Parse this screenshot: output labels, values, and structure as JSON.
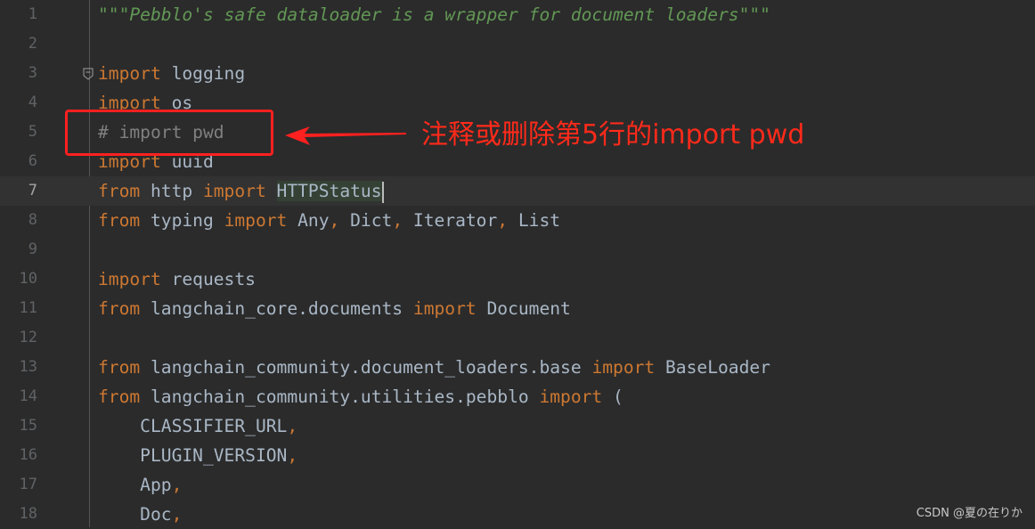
{
  "editor": {
    "current_line": 7,
    "lines": [
      [
        [
          "doc",
          "\"\"\"Pebblo's safe dataloader is a wrapper for document loaders\"\"\""
        ]
      ],
      [],
      [
        [
          "kw",
          "import"
        ],
        [
          "id",
          " logging"
        ]
      ],
      [
        [
          "kw",
          "import"
        ],
        [
          "id",
          " os"
        ]
      ],
      [
        [
          "cm",
          "# import pwd"
        ]
      ],
      [
        [
          "kw",
          "import"
        ],
        [
          "id",
          " uuid"
        ]
      ],
      [
        [
          "kw",
          "from"
        ],
        [
          "id",
          " http "
        ],
        [
          "kw",
          "import"
        ],
        [
          "id",
          " "
        ],
        [
          "hl",
          "HTTPStatus"
        ],
        [
          "caret",
          ""
        ]
      ],
      [
        [
          "kw",
          "from"
        ],
        [
          "id",
          " typing "
        ],
        [
          "kw",
          "import"
        ],
        [
          "id",
          " Any"
        ],
        [
          "punc",
          ","
        ],
        [
          "id",
          " Dict"
        ],
        [
          "punc",
          ","
        ],
        [
          "id",
          " Iterator"
        ],
        [
          "punc",
          ","
        ],
        [
          "id",
          " List"
        ]
      ],
      [],
      [
        [
          "kw",
          "import"
        ],
        [
          "id",
          " requests"
        ]
      ],
      [
        [
          "kw",
          "from"
        ],
        [
          "id",
          " langchain_core.documents "
        ],
        [
          "kw",
          "import"
        ],
        [
          "id",
          " Document"
        ]
      ],
      [],
      [
        [
          "kw",
          "from"
        ],
        [
          "id",
          " langchain_community.document_loaders.base "
        ],
        [
          "kw",
          "import"
        ],
        [
          "id",
          " BaseLoader"
        ]
      ],
      [
        [
          "kw",
          "from"
        ],
        [
          "id",
          " langchain_community.utilities.pebblo "
        ],
        [
          "kw",
          "import"
        ],
        [
          "id",
          " ("
        ]
      ],
      [
        [
          "id",
          "    CLASSIFIER_URL"
        ],
        [
          "punc",
          ","
        ]
      ],
      [
        [
          "id",
          "    PLUGIN_VERSION"
        ],
        [
          "punc",
          ","
        ]
      ],
      [
        [
          "id",
          "    App"
        ],
        [
          "punc",
          ","
        ]
      ],
      [
        [
          "id",
          "    Doc"
        ],
        [
          "punc",
          ","
        ]
      ]
    ]
  },
  "annotation": {
    "note": "注释或删除第5行的import pwd",
    "color": "#ff2020",
    "highlighted_line": 5
  },
  "watermark": "CSDN @夏の在りか",
  "colors": {
    "background": "#2b2b2b",
    "keyword": "#cc7832",
    "identifier": "#a9b7c6",
    "docstring": "#629755",
    "comment": "#808080"
  }
}
